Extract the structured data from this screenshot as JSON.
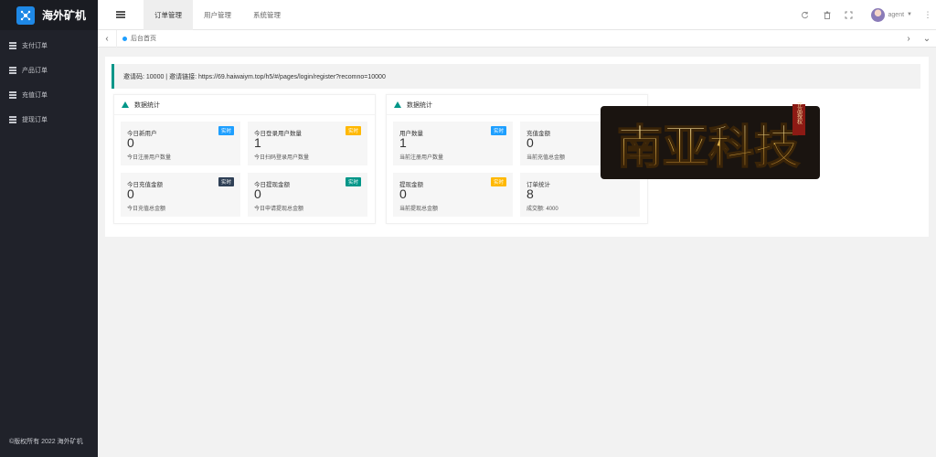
{
  "app": {
    "title": "海外矿机"
  },
  "sidebar": {
    "items": [
      {
        "label": "支付订单"
      },
      {
        "label": "产品订单"
      },
      {
        "label": "充值订单"
      },
      {
        "label": "提现订单"
      }
    ],
    "copyright": "©版权所有 2022 海外矿机"
  },
  "header": {
    "tabs": [
      {
        "label": "订单管理",
        "active": true
      },
      {
        "label": "用户管理",
        "active": false
      },
      {
        "label": "系统管理",
        "active": false
      }
    ],
    "user": {
      "name": "agent"
    }
  },
  "tabbar": {
    "current": "后台首页"
  },
  "invite": {
    "text": "邀请码: 10000 | 邀请链接: https://69.haiwaiym.top/h5/#/pages/login/register?recomno=10000"
  },
  "panels": [
    {
      "title": "数据统计",
      "stats": [
        {
          "title": "今日新用户",
          "badge": "实时",
          "value": "0",
          "desc": "今日注册用户数量"
        },
        {
          "title": "今日登录用户数量",
          "badge": "实时",
          "value": "1",
          "desc": "今日扫码登录用户数量"
        },
        {
          "title": "今日充值金额",
          "badge": "实时",
          "value": "0",
          "desc": "今日充值总金额"
        },
        {
          "title": "今日提现金额",
          "badge": "实时",
          "value": "0",
          "desc": "今日申请提现总金额"
        }
      ]
    },
    {
      "title": "数据统计",
      "stats": [
        {
          "title": "用户数量",
          "badge": "实时",
          "value": "1",
          "desc": "当前注册用户数量"
        },
        {
          "title": "充值金额",
          "badge": "",
          "value": "0",
          "desc": "当前充值总金额"
        },
        {
          "title": "提现金额",
          "badge": "实时",
          "value": "0",
          "desc": "当前提现总金额"
        },
        {
          "title": "订单统计",
          "badge": "",
          "value": "8",
          "desc": "成交额: 4000"
        }
      ]
    }
  ],
  "badge_colors": {
    "blue": "#1e9fff",
    "yellow": "#ffb800",
    "dark": "#2f4056",
    "teal": "#009688"
  },
  "watermark": {
    "text": "南亚科技",
    "small": "正品授权"
  }
}
